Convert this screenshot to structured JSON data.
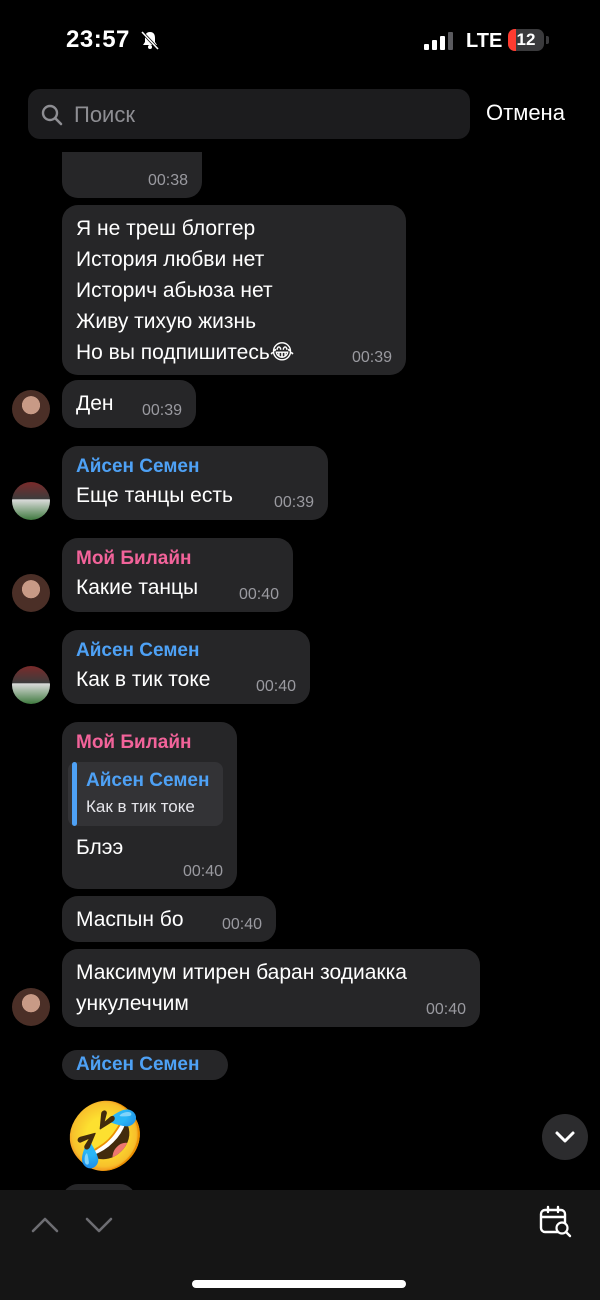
{
  "status_bar": {
    "time": "23:57",
    "network": "LTE",
    "battery": "12"
  },
  "search": {
    "placeholder": "Поиск",
    "cancel_label": "Отмена"
  },
  "messages": [
    {
      "time": "00:38"
    },
    {
      "text": "Я не треш блоггер\nИстория любви нет\nИсторич абьюза нет\nЖиву тихую жизнь\nНо вы подпишитесь😂",
      "time": "00:39"
    },
    {
      "text": "Ден",
      "time": "00:39"
    },
    {
      "sender": "Айсен Семен",
      "text": "Еще танцы есть",
      "time": "00:39"
    },
    {
      "sender": "Мой Билайн",
      "text": "Какие танцы",
      "time": "00:40"
    },
    {
      "sender": "Айсен Семен",
      "text": "Как в тик токе",
      "time": "00:40"
    },
    {
      "sender": "Мой Билайн",
      "reply_sender": "Айсен Семен",
      "reply_text": "Как в тик токе",
      "text": "Блээ",
      "time": "00:40"
    },
    {
      "text": "Маспын бо",
      "time": "00:40"
    },
    {
      "text": "Максимум итирен баран зодиакка\nункулеччим",
      "time": "00:40"
    },
    {
      "sender": "Айсен Семен",
      "emoji": "🤣"
    }
  ],
  "colors": {
    "accent_blue": "#4ea1f5",
    "accent_pink": "#f2639a",
    "bubble": "#262628",
    "battery_low": "#ff3b30"
  }
}
